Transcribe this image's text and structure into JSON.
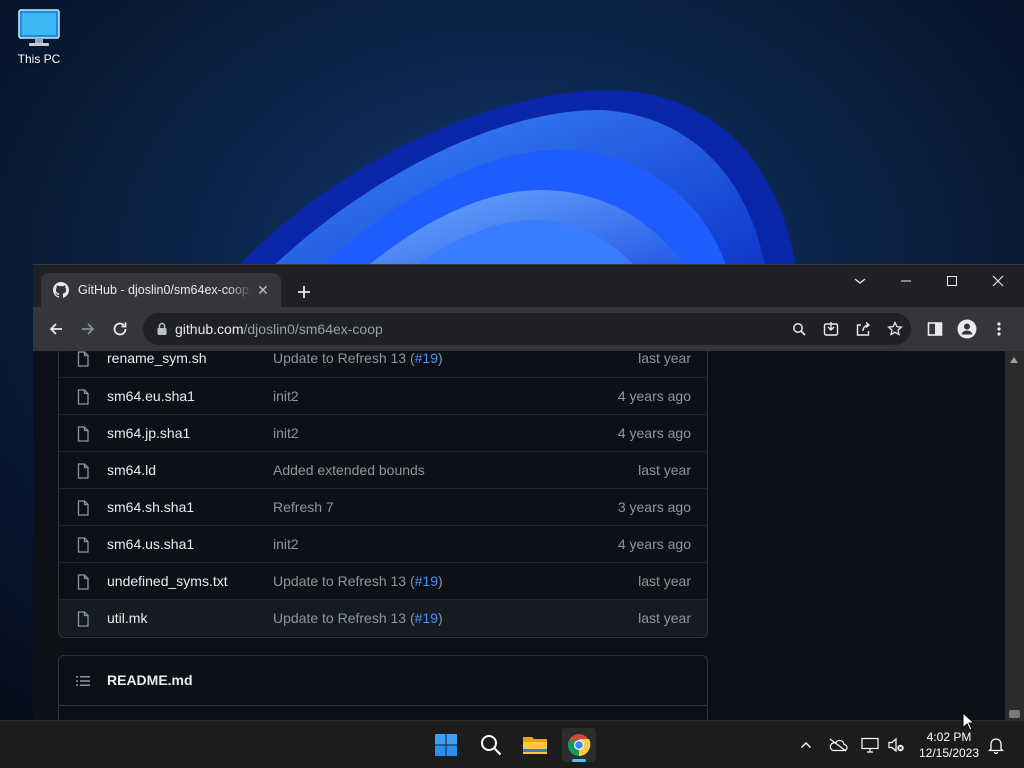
{
  "desktop": {
    "icons": [
      {
        "label": "This PC",
        "icon": "monitor-icon"
      }
    ]
  },
  "browser": {
    "tab": {
      "title": "GitHub - djoslin0/sm64ex-coop: ",
      "icon": "github-icon"
    },
    "address": {
      "host": "github.com",
      "path": "/djoslin0/sm64ex-coop"
    }
  },
  "files": [
    {
      "name": "rename_sym.sh",
      "message": "Update to Refresh 13 (",
      "link": "#19",
      "message_end": ")",
      "age": "last year"
    },
    {
      "name": "sm64.eu.sha1",
      "message": "init2",
      "link": "",
      "message_end": "",
      "age": "4 years ago"
    },
    {
      "name": "sm64.jp.sha1",
      "message": "init2",
      "link": "",
      "message_end": "",
      "age": "4 years ago"
    },
    {
      "name": "sm64.ld",
      "message": "Added extended bounds",
      "link": "",
      "message_end": "",
      "age": "last year"
    },
    {
      "name": "sm64.sh.sha1",
      "message": "Refresh 7",
      "link": "",
      "message_end": "",
      "age": "3 years ago"
    },
    {
      "name": "sm64.us.sha1",
      "message": "init2",
      "link": "",
      "message_end": "",
      "age": "4 years ago"
    },
    {
      "name": "undefined_syms.txt",
      "message": "Update to Refresh 13 (",
      "link": "#19",
      "message_end": ")",
      "age": "last year"
    },
    {
      "name": "util.mk",
      "message": "Update to Refresh 13 (",
      "link": "#19",
      "message_end": ")",
      "age": "last year"
    }
  ],
  "readme": {
    "title": "README.md"
  },
  "taskbar": {
    "apps": [
      "start-icon",
      "search-icon",
      "file-explorer-icon",
      "chrome-icon"
    ],
    "clock": {
      "time": "4:02 PM",
      "date": "12/15/2023"
    }
  },
  "colors": {
    "link": "#4493f8",
    "page_bg": "#0d1117",
    "accent_active": "#4cc2ff"
  }
}
